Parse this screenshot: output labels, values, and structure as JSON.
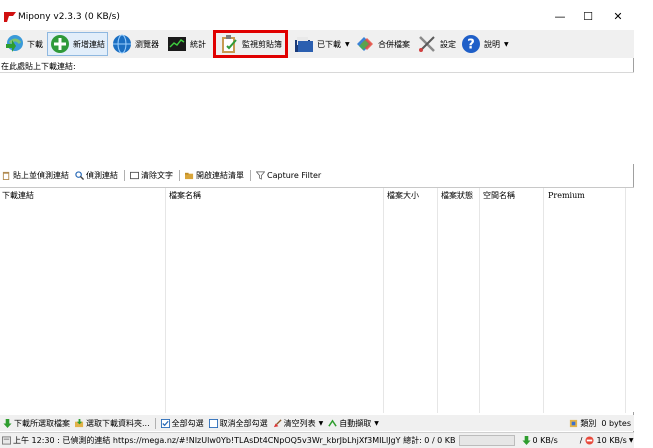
{
  "title": "Mipony v2.3.3 (0 KB/s)",
  "window_controls": {
    "minimize": "—",
    "maximize": "☐",
    "close": "✕"
  },
  "toolbar": {
    "download": "下載",
    "new_link": "新增連結",
    "browser": "瀏覽器",
    "stats": "統計",
    "monitor_clipboard": "監視剪貼簿",
    "downloaded": "已下載",
    "merge_files": "合併檔案",
    "settings": "設定",
    "help": "說明"
  },
  "hint": "在此處貼上下載連結:",
  "subbar": {
    "paste_detect": "貼上並偵測連結",
    "detect_links": "偵測連結",
    "clear_text": "清除文字",
    "open_link_list": "開啟連結清單",
    "capture_filter": "Capture Filter"
  },
  "table": {
    "columns": [
      "下載連結",
      "檔案名稱",
      "檔案大小",
      "檔案狀態",
      "空間名稱",
      "Premium"
    ]
  },
  "bottombar": {
    "download_selected": "下載所選取檔案",
    "select_download_folder": "選取下載資料夾...",
    "select_all": "全部勾選",
    "deselect_all": "取消全部勾選",
    "clear_list": "清空列表",
    "auto_capture": "自動擷取",
    "category": "類別",
    "size": "0 bytes"
  },
  "statusbar": {
    "message": "上午 12:30 : 已偵測的連結 https://mega.nz/#!NIzUlw0Yb!TLAsDt4CNpOQ5v3Wr_kbrJbLhjXf3MILlJgY 總計: 0 / 0 KB",
    "download_speed": "0 KB/s",
    "limit": "/",
    "upload_speed": "10 KB/s"
  }
}
